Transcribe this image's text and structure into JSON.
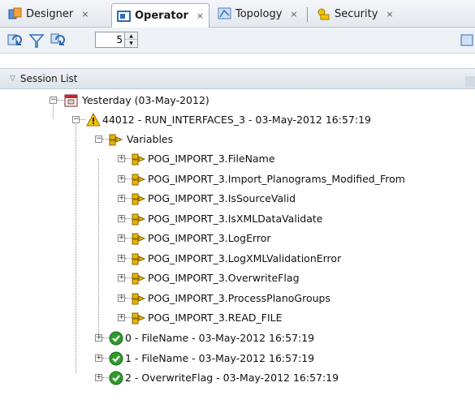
{
  "tabs": [
    {
      "label": "Designer",
      "close": "×",
      "icon": "designer-icon"
    },
    {
      "label": "Operator",
      "close": "×",
      "icon": "operator-icon",
      "active": true
    },
    {
      "label": "Topology",
      "close": "×",
      "icon": "topology-icon"
    },
    {
      "label": "Security",
      "close": "×",
      "icon": "security-icon"
    }
  ],
  "toolbar": {
    "refresh_icon": "refresh-icon",
    "filter_icon": "filter-icon",
    "refresh_all_icon": "refresh-all-icon",
    "count_value": "5",
    "spin_up": "▲",
    "spin_down": "▼"
  },
  "section": {
    "title": "Session List",
    "toggle": "▽"
  },
  "tree": {
    "date_node": "Yesterday (03-May-2012)",
    "session_node": "44012 - RUN_INTERFACES_3 - 03-May-2012 16:57:19",
    "variables_label": "Variables",
    "variables": [
      "POG_IMPORT_3.FileName",
      "POG_IMPORT_3.Import_Planograms_Modified_From",
      "POG_IMPORT_3.IsSourceValid",
      "POG_IMPORT_3.IsXMLDataValidate",
      "POG_IMPORT_3.LogError",
      "POG_IMPORT_3.LogXMLValidationError",
      "POG_IMPORT_3.OverwriteFlag",
      "POG_IMPORT_3.ProcessPlanoGroups",
      "POG_IMPORT_3.READ_FILE"
    ],
    "steps": [
      "0 - FileName - 03-May-2012 16:57:19",
      "1 - FileName - 03-May-2012 16:57:19",
      "2 - OverwriteFlag - 03-May-2012 16:57:19"
    ],
    "expand_glyph": "+",
    "collapse_glyph": "−"
  },
  "colors": {
    "accent": "#2f6cb5",
    "warning": "#f3c400",
    "success": "#2e9a2e",
    "variable": "#e8b400"
  }
}
